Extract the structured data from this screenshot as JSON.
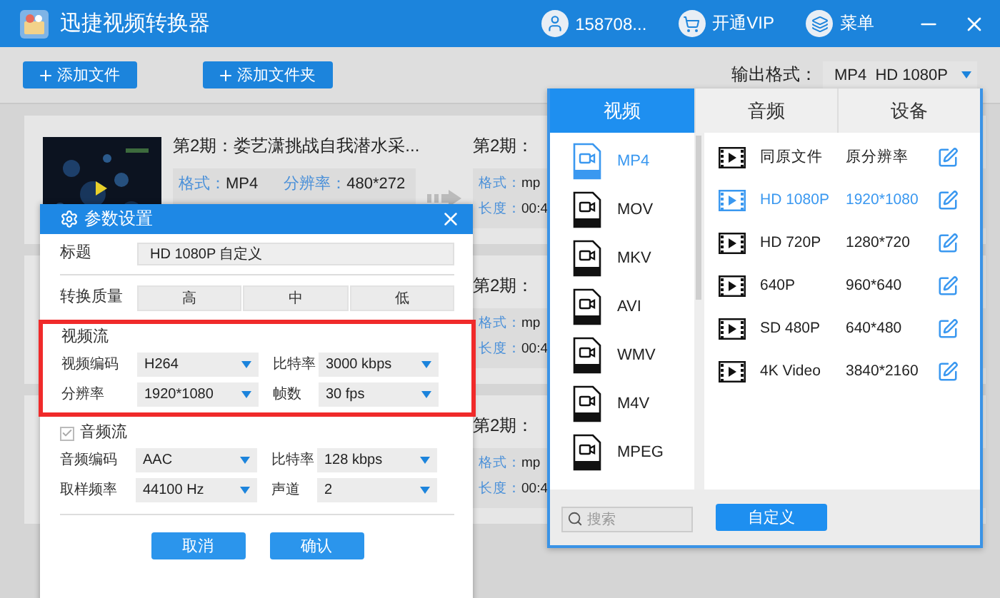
{
  "window": {
    "title": "迅捷视频转换器",
    "account": "158708...",
    "vip": "开通VIP",
    "menu": "菜单"
  },
  "toolbar": {
    "buttons": [
      "添加文件",
      "添加文件夹"
    ],
    "output_label": "输出格式：",
    "output_value": "MP4  HD 1080P"
  },
  "files": [
    {
      "source": {
        "title": "第2期：娄艺潇挑战自我潜水采...",
        "fields": [
          {
            "label": "格式：",
            "value": "MP4"
          },
          {
            "label": "分辨率：",
            "value": "480*272"
          }
        ]
      },
      "output": {
        "title": "第2期：",
        "fields": [
          {
            "label": "格式：",
            "value": "mp"
          },
          {
            "label": "长度：",
            "value": "00:4"
          }
        ]
      }
    },
    {
      "output": {
        "title": "第2期：",
        "fields": [
          {
            "label": "格式：",
            "value": "mp"
          },
          {
            "label": "长度：",
            "value": "00:4"
          }
        ]
      }
    },
    {
      "output": {
        "title": "第2期：",
        "fields": [
          {
            "label": "格式：",
            "value": "mp"
          },
          {
            "label": "长度：",
            "value": "00:4"
          }
        ]
      }
    }
  ],
  "dialog": {
    "title": "参数设置",
    "title_label": "标题",
    "title_value": "HD 1080P 自定义",
    "quality_label": "转换质量",
    "quality_options": [
      "高",
      "中",
      "低"
    ],
    "video": {
      "heading": "视频流",
      "fields": [
        {
          "label": "视频编码",
          "value": "H264"
        },
        {
          "label": "比特率",
          "value": "3000 kbps"
        },
        {
          "label": "分辨率",
          "value": "1920*1080"
        },
        {
          "label": "帧数",
          "value": "30 fps"
        }
      ]
    },
    "audio": {
      "heading": "音频流",
      "checked": true,
      "disabled": true,
      "fields": [
        {
          "label": "音频编码",
          "value": "AAC"
        },
        {
          "label": "比特率",
          "value": "128 kbps"
        },
        {
          "label": "取样频率",
          "value": "44100 Hz"
        },
        {
          "label": "声道",
          "value": "2"
        }
      ]
    },
    "buttons": [
      "取消",
      "确认"
    ]
  },
  "format_panel": {
    "tabs": [
      {
        "label": "视频",
        "selected": true
      },
      {
        "label": "音频",
        "selected": false
      },
      {
        "label": "设备",
        "selected": false
      }
    ],
    "formats": [
      {
        "name": "MP4",
        "selected": true
      },
      {
        "name": "MOV",
        "selected": false
      },
      {
        "name": "MKV",
        "selected": false
      },
      {
        "name": "AVI",
        "selected": false
      },
      {
        "name": "WMV",
        "selected": false
      },
      {
        "name": "M4V",
        "selected": false
      },
      {
        "name": "MPEG",
        "selected": false
      }
    ],
    "presets": [
      {
        "name": "同原文件",
        "resolution": "原分辨率",
        "selected": false
      },
      {
        "name": "HD 1080P",
        "resolution": "1920*1080",
        "selected": true
      },
      {
        "name": "HD 720P",
        "resolution": "1280*720",
        "selected": false
      },
      {
        "name": "640P",
        "resolution": "960*640",
        "selected": false
      },
      {
        "name": "SD 480P",
        "resolution": "640*480",
        "selected": false
      },
      {
        "name": "4K Video",
        "resolution": "3840*2160",
        "selected": false
      }
    ],
    "search_placeholder": "搜索",
    "custom_button": "自定义"
  }
}
